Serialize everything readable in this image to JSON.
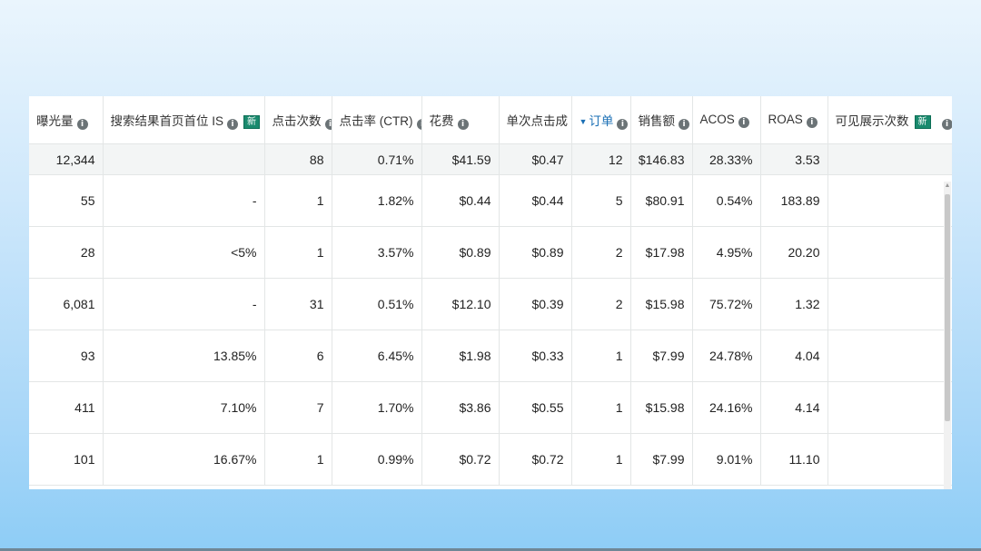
{
  "columns": [
    {
      "label": "曝光量",
      "info": true,
      "new": false,
      "sorted": false
    },
    {
      "label": "搜索结果首页首位 IS",
      "info": true,
      "new": true,
      "sorted": false
    },
    {
      "label": "点击次数",
      "info": true,
      "new": false,
      "sorted": false
    },
    {
      "label": "点击率 (CTR)",
      "info": true,
      "new": false,
      "sorted": false
    },
    {
      "label": "花费",
      "info": true,
      "new": false,
      "sorted": false
    },
    {
      "label": "单次点击成",
      "info": false,
      "new": false,
      "sorted": false
    },
    {
      "label": "订单",
      "info": true,
      "new": false,
      "sorted": true
    },
    {
      "label": "销售额",
      "info": true,
      "new": false,
      "sorted": false
    },
    {
      "label": "ACOS",
      "info": true,
      "new": false,
      "sorted": false
    },
    {
      "label": "ROAS",
      "info": true,
      "new": false,
      "sorted": false
    },
    {
      "label": "可见展示次数",
      "info": true,
      "new": true,
      "sorted": false
    }
  ],
  "new_badge_text": "新",
  "info_glyph": "i",
  "sort_glyph": "▼",
  "totals": [
    "12,344",
    "",
    "88",
    "0.71%",
    "$41.59",
    "$0.47",
    "12",
    "$146.83",
    "28.33%",
    "3.53",
    ""
  ],
  "rows": [
    [
      "55",
      "-",
      "1",
      "1.82%",
      "$0.44",
      "$0.44",
      "5",
      "$80.91",
      "0.54%",
      "183.89",
      ""
    ],
    [
      "28",
      "<5%",
      "1",
      "3.57%",
      "$0.89",
      "$0.89",
      "2",
      "$17.98",
      "4.95%",
      "20.20",
      ""
    ],
    [
      "6,081",
      "-",
      "31",
      "0.51%",
      "$12.10",
      "$0.39",
      "2",
      "$15.98",
      "75.72%",
      "1.32",
      ""
    ],
    [
      "93",
      "13.85%",
      "6",
      "6.45%",
      "$1.98",
      "$0.33",
      "1",
      "$7.99",
      "24.78%",
      "4.04",
      ""
    ],
    [
      "411",
      "7.10%",
      "7",
      "1.70%",
      "$3.86",
      "$0.55",
      "1",
      "$15.98",
      "24.16%",
      "4.14",
      ""
    ],
    [
      "101",
      "16.67%",
      "1",
      "0.99%",
      "$0.72",
      "$0.72",
      "1",
      "$7.99",
      "9.01%",
      "11.10",
      ""
    ]
  ],
  "colors": {
    "accent": "#1a6fb5",
    "badge": "#1a8a6e",
    "total_row_bg": "#f3f5f5"
  }
}
